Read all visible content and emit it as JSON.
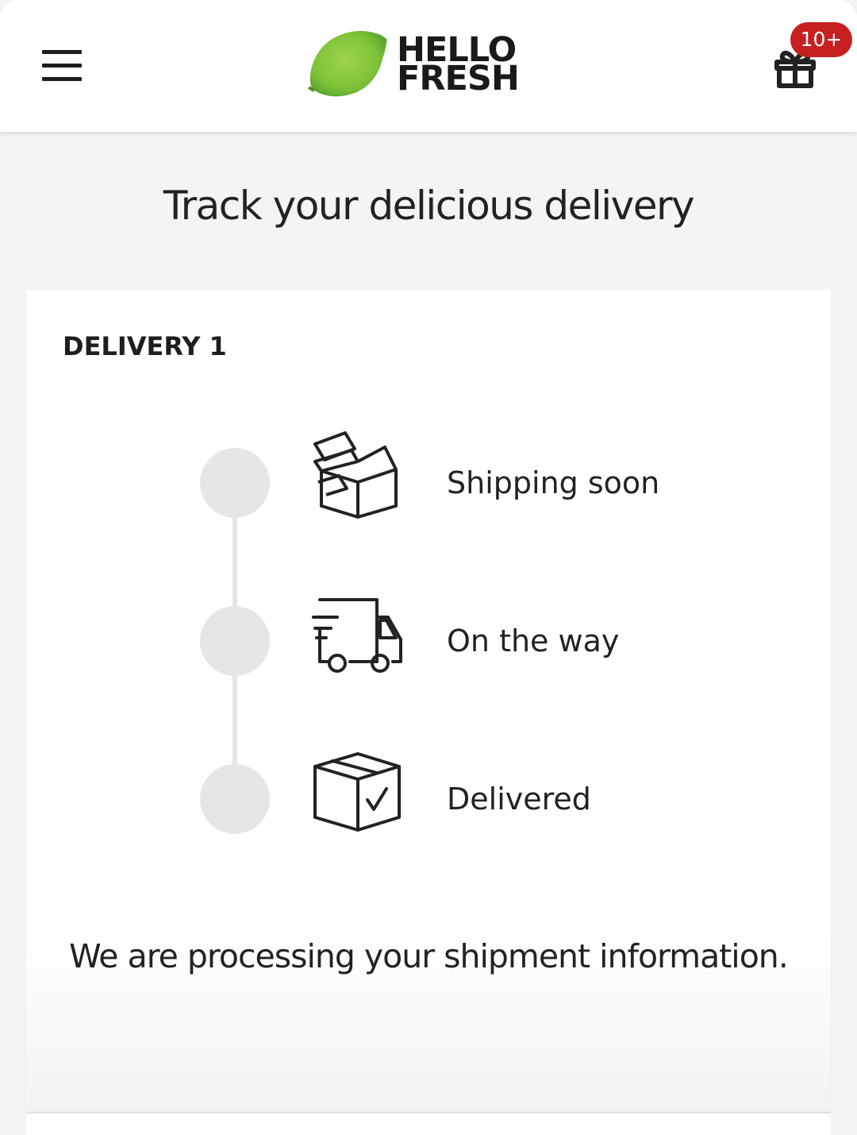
{
  "header": {
    "brand": {
      "line1": "HELLO",
      "line2": "FRESH",
      "logo_color": "#8dc63f"
    },
    "menu_icon": "hamburger-menu-icon",
    "gift_icon": "gift-icon",
    "gift_badge": "10+",
    "badge_color": "#c62020"
  },
  "main": {
    "title": "Track your delicious delivery",
    "delivery": {
      "label": "DELIVERY 1",
      "steps": [
        {
          "label": "Shipping soon",
          "icon": "open-box-icon"
        },
        {
          "label": "On the way",
          "icon": "delivery-truck-icon"
        },
        {
          "label": "Delivered",
          "icon": "box-checked-icon"
        }
      ],
      "message": "We are processing your shipment information."
    }
  }
}
